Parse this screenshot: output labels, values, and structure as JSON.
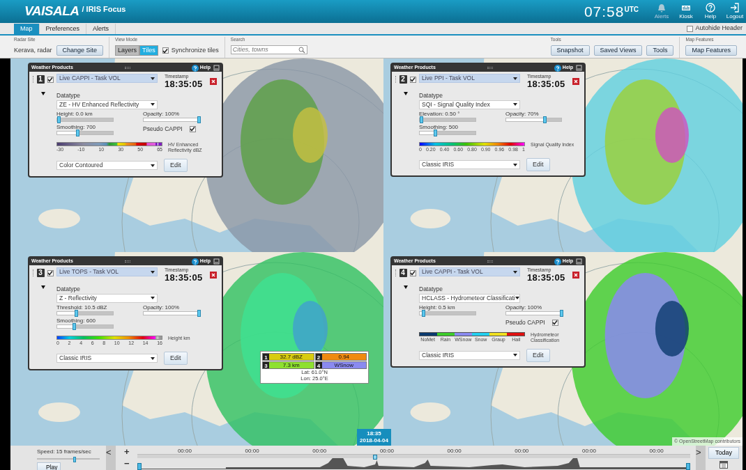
{
  "header": {
    "logo": "VAISALA",
    "product": "/ IRIS Focus",
    "clock": "07:58",
    "clock_zone": "UTC",
    "actions": [
      {
        "label": "Alerts",
        "kind": "bell"
      },
      {
        "label": "Kiosk",
        "kind": "kiosk"
      },
      {
        "label": "Help",
        "kind": "help"
      },
      {
        "label": "Logout",
        "kind": "logout"
      }
    ]
  },
  "tabs": [
    {
      "label": "Map",
      "selected": true
    },
    {
      "label": "Preferences",
      "selected": false
    },
    {
      "label": "Alerts",
      "selected": false
    }
  ],
  "autohide": {
    "label": "Autohide Header",
    "checked": false
  },
  "toolbar": {
    "radar_site": {
      "title": "Radar Site",
      "value": "Kerava, radar",
      "button": "Change Site"
    },
    "view_mode": {
      "title": "View Mode",
      "options": [
        {
          "label": "Layers",
          "selected": false
        },
        {
          "label": "Tiles",
          "selected": true
        }
      ],
      "sync": {
        "label": "Synchronize tiles",
        "checked": true
      }
    },
    "search": {
      "title": "Search",
      "placeholder": "Cities, towns"
    },
    "tools": {
      "title": "Tools",
      "buttons": [
        "Snapshot",
        "Saved Views",
        "Tools"
      ]
    },
    "map_features": {
      "title": "Map Features",
      "button": "Map Features"
    }
  },
  "panels": [
    {
      "title": "Weather Products",
      "help": "Help",
      "number": "1",
      "visible": true,
      "product": "Live CAPPI - Task VOL",
      "timestamp_label": "Timestamp",
      "timestamp": "18:35:05",
      "datatype_label": "Datatype",
      "datatype": "ZE - HV Enhanced Reflectivity",
      "sliders": [
        {
          "label": "Height: 0.0 km",
          "level": 0.02
        },
        {
          "label": "Smoothing: 700",
          "level": 0.36
        }
      ],
      "opacity": {
        "label": "Opacity: 100%",
        "level": 1
      },
      "pseudo_cappi": {
        "label": "Pseudo CAPPI",
        "checked": true
      },
      "legend": {
        "kind": "reflectivity",
        "ticks": [
          "-30",
          "-10",
          "10",
          "30",
          "50",
          "65"
        ],
        "title": "HV Enhanced Reflectivity dBZ"
      },
      "palette": "Color Contoured",
      "edit": "Edit"
    },
    {
      "title": "Weather Products",
      "help": "Help",
      "number": "2",
      "visible": true,
      "product": "Live PPI - Task VOL",
      "timestamp_label": "Timestamp",
      "timestamp": "18:35:05",
      "datatype_label": "Datatype",
      "datatype": "SQI - Signal Quality Index",
      "sliders": [
        {
          "label": "Elevation: 0.50 °",
          "level": 0.02
        },
        {
          "label": "Smoothing: 500",
          "level": 0.27
        }
      ],
      "opacity": {
        "label": "Opacity: 70%",
        "level": 0.69
      },
      "legend": {
        "kind": "sqi",
        "ticks": [
          "0",
          "0.20",
          "0.40",
          "0.60",
          "0.80",
          "0.90",
          "0.96",
          "0.98",
          "1"
        ],
        "title": "Signal Quality Index"
      },
      "palette": "Classic IRIS",
      "edit": "Edit"
    },
    {
      "title": "Weather Products",
      "help": "Help",
      "number": "3",
      "visible": true,
      "product": "Live TOPS - Task VOL",
      "timestamp_label": "Timestamp",
      "timestamp": "18:35:05",
      "datatype_label": "Datatype",
      "datatype": "Z - Reflectivity",
      "sliders": [
        {
          "label": "Threshold: 10.5 dBZ",
          "level": 0.34
        },
        {
          "label": "Smoothing: 600",
          "level": 0.3
        }
      ],
      "opacity": {
        "label": "Opacity: 100%",
        "level": 1
      },
      "legend": {
        "kind": "height",
        "ticks": [
          "0",
          "2",
          "4",
          "6",
          "8",
          "10",
          "12",
          "14",
          "16"
        ],
        "title": "Height km"
      },
      "palette": "Classic IRIS",
      "edit": "Edit"
    },
    {
      "title": "Weather Products",
      "help": "Help",
      "number": "4",
      "visible": true,
      "product": "Live CAPPI - Task VOL",
      "timestamp_label": "Timestamp",
      "timestamp": "18:35:05",
      "datatype_label": "Datatype",
      "datatype": "HCLASS - Hydrometeor Classificati",
      "sliders": [
        {
          "label": "Height: 0.5 km",
          "level": 0.06
        }
      ],
      "opacity": {
        "label": "Opacity: 100%",
        "level": 1
      },
      "pseudo_cappi": {
        "label": "Pseudo CAPPI",
        "checked": true
      },
      "legend": {
        "kind": "classes",
        "classes": [
          {
            "label": "NoMet",
            "color": "#0b3a6e"
          },
          {
            "label": "Rain",
            "color": "#3ccc2a"
          },
          {
            "label": "WSnow",
            "color": "#8a8af0"
          },
          {
            "label": "Snow",
            "color": "#22d0f0"
          },
          {
            "label": "Graup",
            "color": "#f0e020"
          },
          {
            "label": "Hail",
            "color": "#e01010"
          }
        ],
        "title": "Hydrometeor Classification"
      },
      "palette": "Classic IRIS",
      "edit": "Edit"
    }
  ],
  "tooltip": {
    "cells": [
      {
        "number": "1",
        "value": "32.7 dBZ",
        "color": "#d8cc10"
      },
      {
        "number": "2",
        "value": "0.94",
        "color": "#f08a10"
      },
      {
        "number": "3",
        "value": "7.3 km",
        "color": "#8ee030"
      },
      {
        "number": "4",
        "value": "WSnow",
        "color": "#8a8af0"
      }
    ],
    "lat": "Lat: 61.0°N",
    "lon": "Lon: 25.0°E"
  },
  "time_marker": {
    "time": "18:35",
    "date": "2018-04-04"
  },
  "attribution": "© OpenStreetMap contributors",
  "timeline": {
    "speed_label": "Speed: 15 frames/sec",
    "speed": {
      "level": 0.6
    },
    "play": "Play",
    "prev": "<",
    "zoom_in": "+",
    "zoom_out": "−",
    "ticks": [
      "00:00",
      "00:00",
      "00:00",
      "00:00",
      "00:00",
      "00:00",
      "00:00",
      "00:00"
    ],
    "position": {
      "level": 0.43
    },
    "next": ">",
    "today": "Today"
  }
}
